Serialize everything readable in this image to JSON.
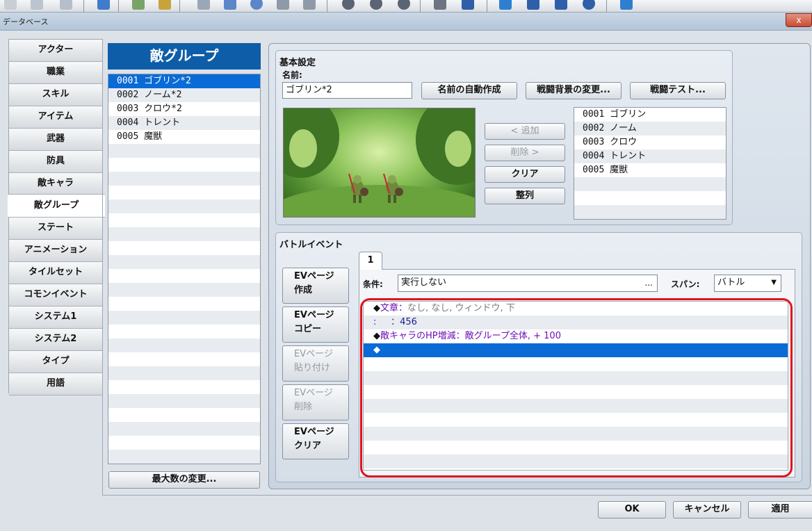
{
  "window": {
    "title": "データベース",
    "close_label": "x"
  },
  "tabs": [
    "アクター",
    "職業",
    "スキル",
    "アイテム",
    "武器",
    "防具",
    "敵キャラ",
    "敵グループ",
    "ステート",
    "アニメーション",
    "タイルセット",
    "コモンイベント",
    "システム1",
    "システム2",
    "タイプ",
    "用語"
  ],
  "active_tab": "敵グループ",
  "group_panel": {
    "header": "敵グループ",
    "items": [
      "0001 ゴブリン*2",
      "0002 ノーム*2",
      "0003 クロウ*2",
      "0004 トレント",
      "0005 魔獣"
    ],
    "selected_index": 0,
    "max_button": "最大数の変更..."
  },
  "basic": {
    "section_title": "基本設定",
    "name_label": "名前:",
    "name_value": "ゴブリン*2",
    "auto_name_button": "名前の自動作成",
    "change_bg_button": "戦闘背景の変更...",
    "battle_test_button": "戦闘テスト...",
    "add_button": "< 追加",
    "remove_button": "削除 >",
    "clear_button": "クリア",
    "align_button": "整列",
    "enemies": [
      "0001 ゴブリン",
      "0002 ノーム",
      "0003 クロウ",
      "0004 トレント",
      "0005 魔獣"
    ]
  },
  "battle_event": {
    "section_title": "バトルイベント",
    "page_buttons": [
      "EVページ\n作成",
      "EVページ\nコピー",
      "EVページ\n貼り付け",
      "EVページ\n削除",
      "EVページ\nクリア"
    ],
    "page_tab": "1",
    "condition_label": "条件:",
    "condition_value": "実行しない",
    "condition_more": "...",
    "span_label": "スパン:",
    "span_value": "バトル",
    "commands": [
      {
        "marker": "◆",
        "name": "文章",
        "sep": "：",
        "detail": "なし, なし, ウィンドウ, 下"
      },
      {
        "marker": "",
        "name": ":",
        "sep": "     ：",
        "detail": "456"
      },
      {
        "marker": "◆",
        "name": "敵キャラのHP増減",
        "sep": "：",
        "detail": "敵グループ全体, + 100"
      },
      {
        "marker": "◆",
        "name": "",
        "sep": "",
        "detail": ""
      }
    ],
    "selected_command": 3
  },
  "footer": {
    "ok": "OK",
    "cancel": "キャンセル",
    "apply": "適用"
  },
  "colors": {
    "accent": "#0e5da8",
    "selection": "#0a6bd6",
    "highlight_box": "#e0141e",
    "command_name": "#6b0fb8",
    "command_detail": "#7a7a7a",
    "number": "#1b1b8a"
  }
}
